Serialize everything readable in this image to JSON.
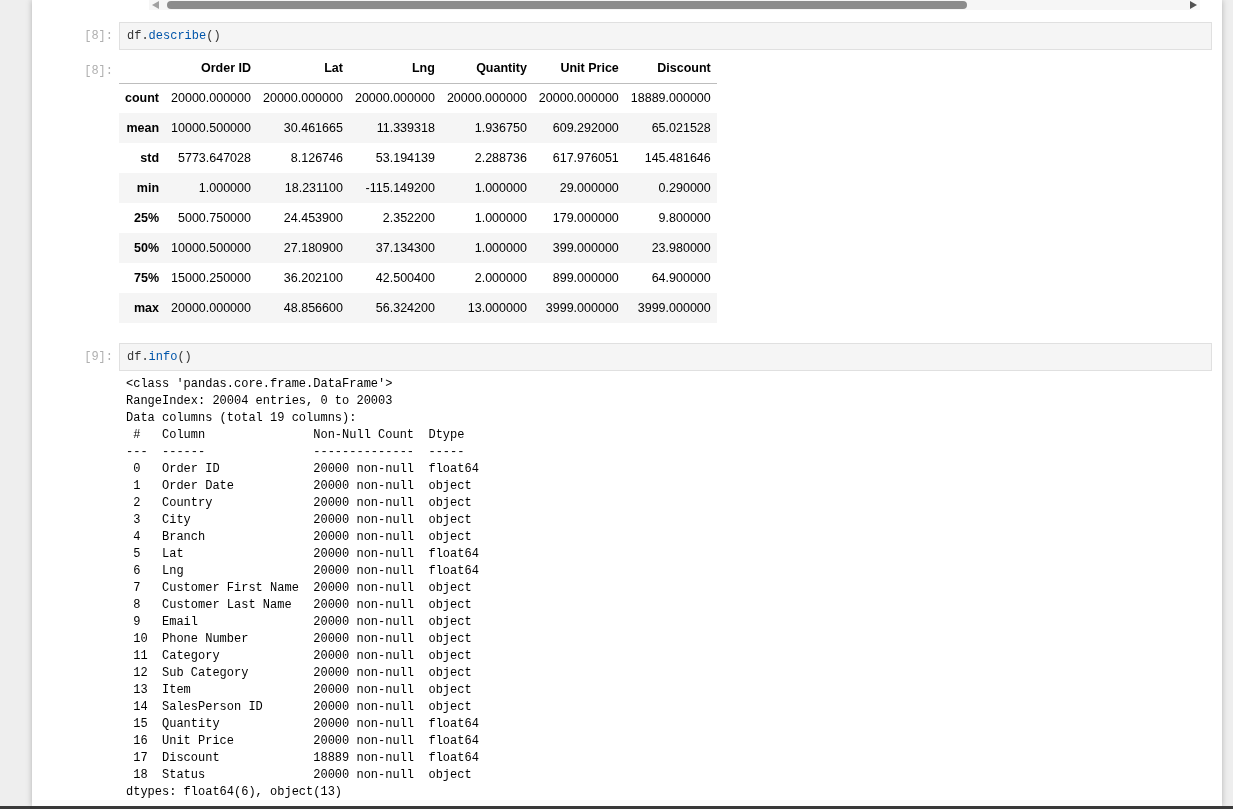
{
  "cells": [
    {
      "prompt": "[8]:",
      "code": [
        {
          "text": "df.",
          "kind": "plain"
        },
        {
          "text": "describe",
          "kind": "name"
        },
        {
          "text": "()",
          "kind": "plain"
        }
      ],
      "output": {
        "kind": "table",
        "prompt": "[8]:",
        "columns": [
          "Order ID",
          "Lat",
          "Lng",
          "Quantity",
          "Unit Price",
          "Discount"
        ],
        "rows": [
          {
            "index": "count",
            "cells": [
              "20000.000000",
              "20000.000000",
              "20000.000000",
              "20000.000000",
              "20000.000000",
              "18889.000000"
            ]
          },
          {
            "index": "mean",
            "cells": [
              "10000.500000",
              "30.461665",
              "11.339318",
              "1.936750",
              "609.292000",
              "65.021528"
            ]
          },
          {
            "index": "std",
            "cells": [
              "5773.647028",
              "8.126746",
              "53.194139",
              "2.288736",
              "617.976051",
              "145.481646"
            ]
          },
          {
            "index": "min",
            "cells": [
              "1.000000",
              "18.231100",
              "-115.149200",
              "1.000000",
              "29.000000",
              "0.290000"
            ]
          },
          {
            "index": "25%",
            "cells": [
              "5000.750000",
              "24.453900",
              "2.352200",
              "1.000000",
              "179.000000",
              "9.800000"
            ]
          },
          {
            "index": "50%",
            "cells": [
              "10000.500000",
              "27.180900",
              "37.134300",
              "1.000000",
              "399.000000",
              "23.980000"
            ]
          },
          {
            "index": "75%",
            "cells": [
              "15000.250000",
              "36.202100",
              "42.500400",
              "2.000000",
              "899.000000",
              "64.900000"
            ]
          },
          {
            "index": "max",
            "cells": [
              "20000.000000",
              "48.856600",
              "56.324200",
              "13.000000",
              "3999.000000",
              "3999.000000"
            ]
          }
        ]
      }
    },
    {
      "prompt": "[9]:",
      "code": [
        {
          "text": "df.",
          "kind": "plain"
        },
        {
          "text": "info",
          "kind": "name"
        },
        {
          "text": "()",
          "kind": "plain"
        }
      ],
      "output": {
        "kind": "text",
        "lines": [
          "<class 'pandas.core.frame.DataFrame'>",
          "RangeIndex: 20004 entries, 0 to 20003",
          "Data columns (total 19 columns):",
          " #   Column               Non-Null Count  Dtype  ",
          "---  ------               --------------  -----  ",
          " 0   Order ID             20000 non-null  float64",
          " 1   Order Date           20000 non-null  object ",
          " 2   Country              20000 non-null  object ",
          " 3   City                 20000 non-null  object ",
          " 4   Branch               20000 non-null  object ",
          " 5   Lat                  20000 non-null  float64",
          " 6   Lng                  20000 non-null  float64",
          " 7   Customer First Name  20000 non-null  object ",
          " 8   Customer Last Name   20000 non-null  object ",
          " 9   Email                20000 non-null  object ",
          " 10  Phone Number         20000 non-null  object ",
          " 11  Category             20000 non-null  object ",
          " 12  Sub Category         20000 non-null  object ",
          " 13  Item                 20000 non-null  object ",
          " 14  SalesPerson ID       20000 non-null  object ",
          " 15  Quantity             20000 non-null  float64",
          " 16  Unit Price           20000 non-null  float64",
          " 17  Discount             18889 non-null  float64",
          " 18  Status               20000 non-null  object ",
          "dtypes: float64(6), object(13)"
        ]
      }
    }
  ]
}
